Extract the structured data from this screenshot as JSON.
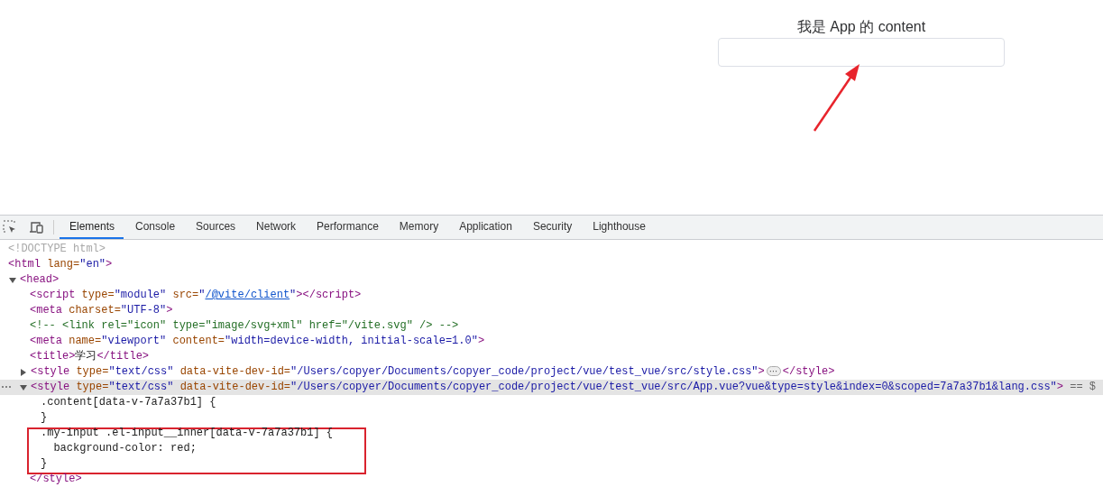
{
  "page": {
    "heading": "我是 App 的 content"
  },
  "devtools": {
    "tabs": [
      {
        "label": "Elements",
        "selected": true
      },
      {
        "label": "Console",
        "selected": false
      },
      {
        "label": "Sources",
        "selected": false
      },
      {
        "label": "Network",
        "selected": false
      },
      {
        "label": "Performance",
        "selected": false
      },
      {
        "label": "Memory",
        "selected": false
      },
      {
        "label": "Application",
        "selected": false
      },
      {
        "label": "Security",
        "selected": false
      },
      {
        "label": "Lighthouse",
        "selected": false
      }
    ],
    "dom_tree": [
      {
        "segments": [
          {
            "kind": "doctype",
            "text": "<!DOCTYPE html>"
          }
        ]
      },
      {
        "segments": [
          {
            "kind": "tag",
            "text": "<html"
          },
          {
            "kind": "attr",
            "text": " lang="
          },
          {
            "kind": "value",
            "text": "\"en\""
          },
          {
            "kind": "tag",
            "text": ">"
          }
        ],
        "children": [
          {
            "expanded": true,
            "segments": [
              {
                "kind": "tag",
                "text": "<head>"
              }
            ],
            "children": [
              {
                "segments": [
                  {
                    "kind": "tag",
                    "text": "<script"
                  },
                  {
                    "kind": "attr",
                    "text": " type="
                  },
                  {
                    "kind": "value",
                    "text": "\"module\""
                  },
                  {
                    "kind": "attr",
                    "text": " src="
                  },
                  {
                    "kind": "value",
                    "text": "\""
                  },
                  {
                    "kind": "link",
                    "text": "/@vite/client"
                  },
                  {
                    "kind": "value",
                    "text": "\""
                  },
                  {
                    "kind": "tag",
                    "text": "></script>"
                  }
                ]
              },
              {
                "segments": [
                  {
                    "kind": "tag",
                    "text": "<meta"
                  },
                  {
                    "kind": "attr",
                    "text": " charset="
                  },
                  {
                    "kind": "value",
                    "text": "\"UTF-8\""
                  },
                  {
                    "kind": "tag",
                    "text": ">"
                  }
                ]
              },
              {
                "segments": [
                  {
                    "kind": "comment",
                    "text": "<!-- <link rel=\"icon\" type=\"image/svg+xml\" href=\"/vite.svg\" /> -->"
                  }
                ]
              },
              {
                "segments": [
                  {
                    "kind": "tag",
                    "text": "<meta"
                  },
                  {
                    "kind": "attr",
                    "text": " name="
                  },
                  {
                    "kind": "value",
                    "text": "\"viewport\""
                  },
                  {
                    "kind": "attr",
                    "text": " content="
                  },
                  {
                    "kind": "value",
                    "text": "\"width=device-width, initial-scale=1.0\""
                  },
                  {
                    "kind": "tag",
                    "text": ">"
                  }
                ]
              },
              {
                "segments": [
                  {
                    "kind": "tag",
                    "text": "<title>"
                  },
                  {
                    "kind": "text",
                    "text": "学习"
                  },
                  {
                    "kind": "tag",
                    "text": "</title>"
                  }
                ]
              },
              {
                "expanded": false,
                "selected": false,
                "segments": [
                  {
                    "kind": "tag",
                    "text": "<style"
                  },
                  {
                    "kind": "attr",
                    "text": " type="
                  },
                  {
                    "kind": "value",
                    "text": "\"text/css\""
                  },
                  {
                    "kind": "attr",
                    "text": " data-vite-dev-id="
                  },
                  {
                    "kind": "value",
                    "text": "\"/Users/copyer/Documents/copyer_code/project/vue/test_vue/src/style.css\""
                  },
                  {
                    "kind": "tag",
                    "text": ">"
                  },
                  {
                    "kind": "badge",
                    "text": "⋯"
                  },
                  {
                    "kind": "tag",
                    "text": "</style>"
                  }
                ]
              },
              {
                "expanded": true,
                "selected": true,
                "segments": [
                  {
                    "kind": "tag",
                    "text": "<style"
                  },
                  {
                    "kind": "attr",
                    "text": " type="
                  },
                  {
                    "kind": "value",
                    "text": "\"text/css\""
                  },
                  {
                    "kind": "attr",
                    "text": " data-vite-dev-id="
                  },
                  {
                    "kind": "value",
                    "text": "\"/Users/copyer/Documents/copyer_code/project/vue/test_vue/src/App.vue?vue&type=style&index=0&scoped=7a7a37b1&lang.css\""
                  },
                  {
                    "kind": "tag",
                    "text": ">"
                  },
                  {
                    "kind": "hint",
                    "text": " == $"
                  }
                ],
                "children": [
                  {
                    "segments": [
                      {
                        "kind": "text",
                        "text": ".content[data-v-7a7a37b1] {"
                      }
                    ]
                  },
                  {
                    "segments": [
                      {
                        "kind": "text",
                        "text": "}"
                      }
                    ]
                  },
                  {
                    "segments": [
                      {
                        "kind": "text",
                        "text": ".my-input .el-input__inner[data-v-7a7a37b1] {"
                      }
                    ]
                  },
                  {
                    "segments": [
                      {
                        "kind": "text",
                        "text": "  background-color: red;"
                      }
                    ]
                  },
                  {
                    "segments": [
                      {
                        "kind": "text",
                        "text": "}"
                      }
                    ]
                  }
                ],
                "closing": [
                  {
                    "kind": "tag",
                    "text": "</style>"
                  }
                ]
              }
            ]
          }
        ]
      }
    ]
  }
}
